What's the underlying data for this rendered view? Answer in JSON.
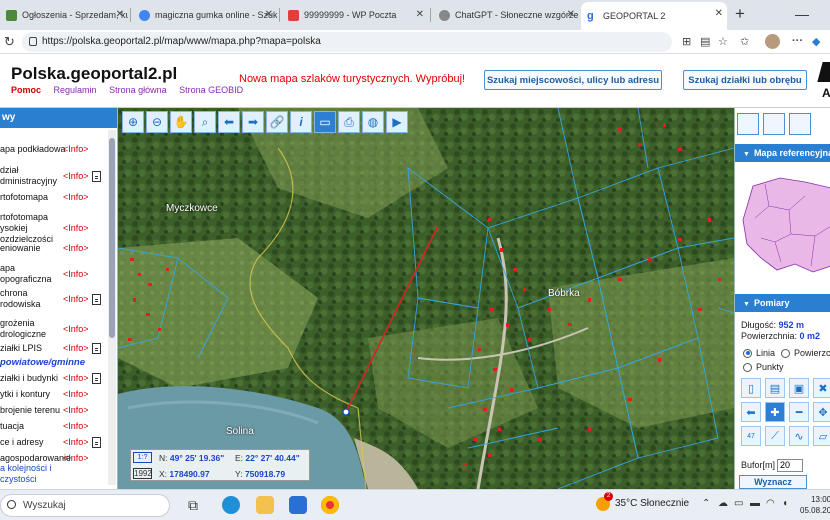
{
  "browser": {
    "tabs": [
      {
        "label": "Ogłoszenia - Sprzedam, kupię",
        "fav": "#4c8a3a"
      },
      {
        "label": "magiczna gumka online - Szuka",
        "fav": "#4285f4"
      },
      {
        "label": "99999999 - WP Poczta",
        "fav": "#e0403a"
      },
      {
        "label": "ChatGPT - Słoneczne wzgórze",
        "fav": "#888888"
      },
      {
        "label": "GEOPORTAL 2",
        "fav": "#ffffff"
      }
    ],
    "url": "https://polska.geoportal2.pl/map/www/mapa.php?mapa=polska"
  },
  "header": {
    "title": "Polska.geoportal2.pl",
    "nav": [
      "Pomoc",
      "Regulamin",
      "Strona główna",
      "Strona GEOBID"
    ],
    "promo": "Nowa mapa szlaków turystycznych. Wypróbuj!",
    "btn_search_place": "Szukaj miejscowości, ulicy lub adresu",
    "btn_search_parcel": "Szukaj działki lub obrębu",
    "logo_letter": "A"
  },
  "left_panel": {
    "head": "wy",
    "info_label": "<Info>",
    "layers": [
      {
        "label": "apa podkładowa",
        "doc": false
      },
      {
        "label": "dział\ndministracyjny",
        "doc": true
      },
      {
        "label": "rtofotomapa",
        "doc": false
      },
      {
        "label": "rtofotomapa\nysokiej\nozdzielczości",
        "doc": false
      },
      {
        "label": "eniowanie",
        "doc": false
      },
      {
        "label": "apa\nopograficzna",
        "doc": false
      },
      {
        "label": "chrona\nrodowiska",
        "doc": true
      },
      {
        "label": "grożenia\ndrologiczne",
        "doc": false
      },
      {
        "label": "ziałki LPIS",
        "doc": true
      },
      {
        "label": "ziałki i budynki",
        "doc": true
      },
      {
        "label": "ytki i kontury",
        "doc": false
      },
      {
        "label": "brojenie terenu",
        "doc": false
      },
      {
        "label": "tuacja",
        "doc": false
      },
      {
        "label": "ce i adresy",
        "doc": true
      },
      {
        "label": "agospodarowanie",
        "doc": false
      }
    ],
    "section_powiat": "powiatowe/gminne",
    "link_bottom": "a kolejności i\nczystości"
  },
  "map": {
    "labels": {
      "west": "Myczkowce",
      "east": "Bóbrka",
      "south": "Solina"
    },
    "coords": {
      "n_label": "N:",
      "n_value": "49° 25' 19.36\"",
      "e_label": "E:",
      "e_value": "22° 27' 40.44\"",
      "x_label": "X:",
      "x_value": "178490.97",
      "y_label": "Y:",
      "y_value": "750918.79",
      "scale_icon": "1:?",
      "year": "1992"
    }
  },
  "right_panel": {
    "ref_map_head": "Mapa referencyjna",
    "measure_head": "Pomiary",
    "length_label": "Długość:",
    "length_value": "952 m",
    "area_label": "Powierzchnia:",
    "area_value": "0 m2",
    "radio_line": "Linia",
    "radio_poly": "Powierzchnia",
    "radio_points": "Punkty",
    "buffer_label": "Bufor[m]",
    "buffer_value": "20",
    "compute_btn": "Wyznacz",
    "small_num": "47"
  },
  "taskbar": {
    "search": "Wyszukaj",
    "weather": "35°C  Słonecznie",
    "notify_count": "2",
    "time": "13:00",
    "date": "05.08.20"
  },
  "colors": {
    "accent": "#2b7fd1",
    "info": "#d00000",
    "measure_line": "#e02020"
  }
}
